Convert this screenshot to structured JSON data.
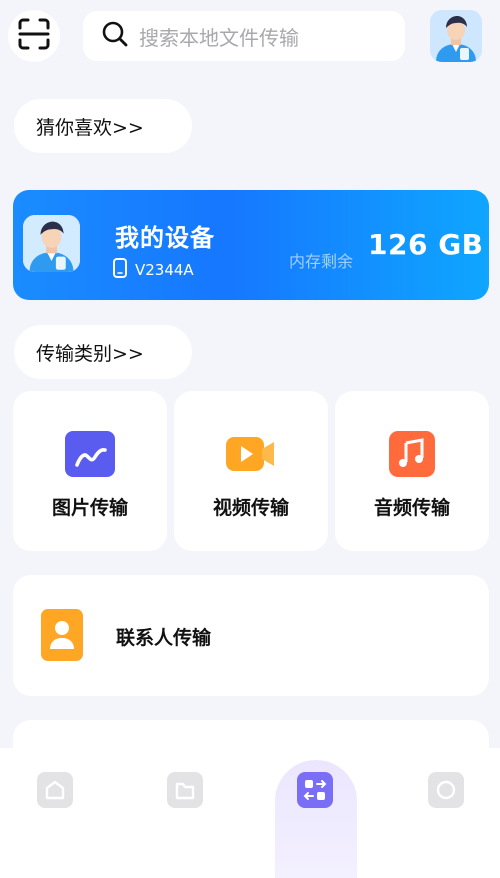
{
  "header": {
    "search_placeholder": "搜索本地文件传输",
    "icons": {
      "scan": "scan-icon",
      "search": "search-icon",
      "avatar": "avatar"
    }
  },
  "sections": {
    "guess_title": "猜你喜欢>>",
    "category_title": "传输类别>>"
  },
  "device": {
    "name": "我的设备",
    "model": "V2344A",
    "storage_label": "内存剩余",
    "storage_value": "126 GB"
  },
  "categories": [
    {
      "label": "图片传输",
      "icon": "image-icon",
      "color": "#5a5cf0"
    },
    {
      "label": "视频传输",
      "icon": "video-icon",
      "color": "#ffa624"
    },
    {
      "label": "音频传输",
      "icon": "music-icon",
      "color": "#ff6b3d"
    }
  ],
  "contacts": {
    "label": "联系人传输",
    "icon": "contact-icon",
    "color": "#ffa624"
  },
  "tabbar": {
    "items": [
      {
        "icon": "home-icon",
        "active": false
      },
      {
        "icon": "folder-icon",
        "active": false
      },
      {
        "icon": "transfer-icon",
        "active": true
      },
      {
        "icon": "profile-icon",
        "active": false
      }
    ],
    "colors": {
      "active": "#7b6ef6",
      "inactive": "#e3e3e6"
    }
  },
  "colors": {
    "accent": "#1677ff",
    "background": "#f3f5fa"
  }
}
